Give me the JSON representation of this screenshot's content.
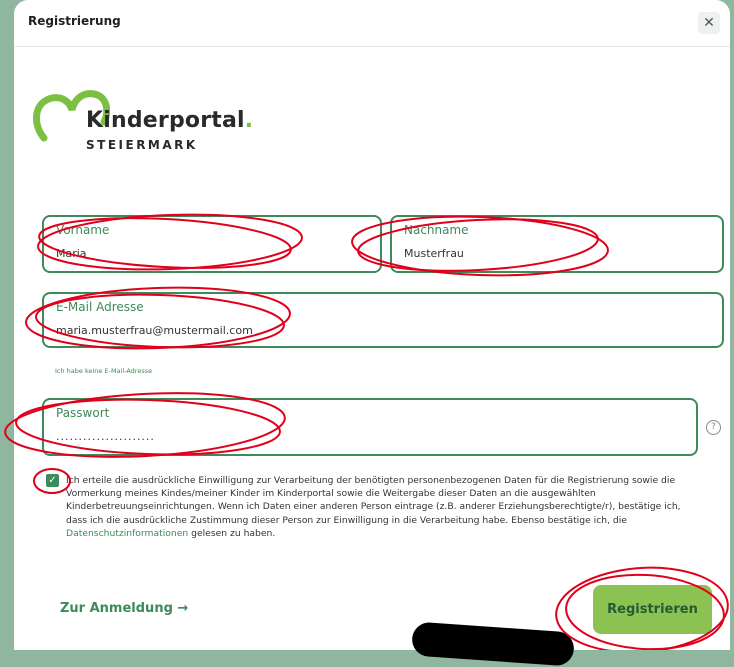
{
  "dialog": {
    "title": "Registrierung",
    "close_glyph": "✕"
  },
  "logo": {
    "name": "Kinderportal",
    "dot": ".",
    "region": "STEIERMARK",
    "accent": "#7cc043"
  },
  "form": {
    "vorname": {
      "label": "Vorname",
      "value": "Maria"
    },
    "nachname": {
      "label": "Nachname",
      "value": "Musterfrau"
    },
    "email": {
      "label": "E-Mail Adresse",
      "value": "maria.musterfrau@mustermail.com"
    },
    "no_email_link": "Ich habe keine E-Mail-Adresse",
    "passwort": {
      "label": "Passwort",
      "value": "......................"
    },
    "help_glyph": "?"
  },
  "consent": {
    "checked": true,
    "check_glyph": "✓",
    "text": "Ich erteile die ausdrückliche Einwilligung zur Verarbeitung der benötigten personenbezogenen Daten für die Registrierung sowie die Vormerkung meines Kindes/meiner Kinder im Kinderportal sowie die Weitergabe dieser Daten an die ausgewählten Kinderbetreuungseinrichtungen. Wenn ich Daten einer anderen Person eintrage (z.B. anderer Erziehungsberechtigte/r), bestätige ich, dass ich die ausdrückliche Zustimmung dieser Person zur Einwilligung in die Verarbeitung habe. Ebenso bestätige ich, die",
    "link": "Datenschutzinformationen",
    "suffix": "gelesen zu haben."
  },
  "footer": {
    "login_link": "Zur Anmeldung →",
    "register_button": "Registrieren"
  },
  "colors": {
    "primary": "#3d8a5a",
    "button": "#8cc251",
    "background": "#8fb79f",
    "annotation": "#e0001b"
  }
}
